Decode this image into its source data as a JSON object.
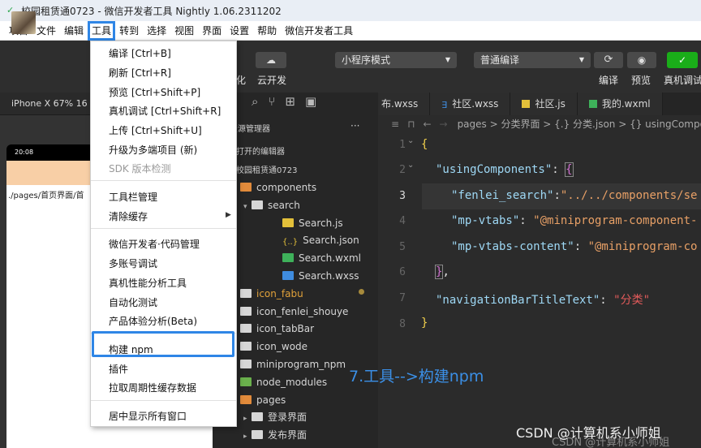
{
  "window": {
    "title": "校园租赁通0723 - 微信开发者工具 Nightly 1.06.2311202"
  },
  "menubar": {
    "items": [
      "项目",
      "文件",
      "编辑",
      "工具",
      "转到",
      "选择",
      "视图",
      "界面",
      "设置",
      "帮助",
      "微信开发者工具"
    ]
  },
  "toolbar": {
    "labels": [
      "化",
      "云开发"
    ],
    "mode_select": "小程序模式",
    "compile_select": "普通编译",
    "right_labels": [
      "编译",
      "预览",
      "真机调试"
    ]
  },
  "simulator": {
    "device": "iPhone X 67% 16 ▾",
    "time": "20:08",
    "path": "./pages/首页界面/首"
  },
  "explorer": {
    "header": "资源管理器",
    "more": "···",
    "open_editors": "打开的编辑器",
    "project": "校园租赁通0723",
    "rows": [
      {
        "label": "components",
        "icon": "folder-orange",
        "indent": 0,
        "arrow": "▾"
      },
      {
        "label": "search",
        "icon": "folder",
        "indent": 1,
        "arrow": "▾"
      },
      {
        "label": "Search.js",
        "icon": "js-ic",
        "indent": 2,
        "arrow": ""
      },
      {
        "label": "Search.json",
        "icon": "json-ic",
        "indent": 2,
        "arrow": ""
      },
      {
        "label": "Search.wxml",
        "icon": "wxml-ic",
        "indent": 2,
        "arrow": ""
      },
      {
        "label": "Search.wxss",
        "icon": "wxss-ic",
        "indent": 2,
        "arrow": ""
      },
      {
        "label": "icon_fabu",
        "icon": "folder",
        "indent": 0,
        "arrow": "▸"
      },
      {
        "label": "icon_fenlei_shouye",
        "icon": "folder",
        "indent": 0,
        "arrow": "▸"
      },
      {
        "label": "icon_tabBar",
        "icon": "folder",
        "indent": 0,
        "arrow": "▸"
      },
      {
        "label": "icon_wode",
        "icon": "folder",
        "indent": 0,
        "arrow": "▸"
      },
      {
        "label": "miniprogram_npm",
        "icon": "folder",
        "indent": 0,
        "arrow": "▸"
      },
      {
        "label": "node_modules",
        "icon": "folder-green",
        "indent": 0,
        "arrow": "▸"
      },
      {
        "label": "pages",
        "icon": "folder-orange",
        "indent": 0,
        "arrow": "▾"
      },
      {
        "label": "登录界面",
        "icon": "folder",
        "indent": 1,
        "arrow": "▸"
      },
      {
        "label": "发布界面",
        "icon": "folder",
        "indent": 1,
        "arrow": "▸"
      }
    ]
  },
  "tabs": [
    {
      "label": "布.wxss",
      "color": "#3f8cdf"
    },
    {
      "label": "社区.wxss",
      "color": "#3f8cdf"
    },
    {
      "label": "社区.js",
      "color": "#e3c03a"
    },
    {
      "label": "我的.wxml",
      "color": "#3eb15a"
    }
  ],
  "breadcrumb": "pages > 分类界面 > {.} 分类.json > {} usingComponents",
  "editor": {
    "line_numbers": [
      "1",
      "2",
      "3",
      "4",
      "5",
      "6",
      "7",
      "8"
    ],
    "l1": "{",
    "l2_key": "\"usingComponents\"",
    "l2_rest": ": ",
    "l2_brace": "{",
    "l3_key": "\"fenlei_search\"",
    "l3_colon": ":",
    "l3_val": "\"../../components/se",
    "l4_key": "\"mp-vtabs\"",
    "l4_colon": ": ",
    "l4_val": "\"@miniprogram-component-",
    "l5_key": "\"mp-vtabs-content\"",
    "l5_colon": ": ",
    "l5_val": "\"@miniprogram-co",
    "l6_brace": "}",
    "l6_comma": ",",
    "l7_key": "\"navigationBarTitleText\"",
    "l7_colon": ": ",
    "l7_val": "\"分类\"",
    "l8": "}"
  },
  "dropdown": {
    "items": [
      {
        "label": "编译  [Ctrl+B]"
      },
      {
        "label": "刷新  [Ctrl+R]"
      },
      {
        "label": "预览  [Ctrl+Shift+P]"
      },
      {
        "label": "真机调试  [Ctrl+Shift+R]"
      },
      {
        "label": "上传  [Ctrl+Shift+U]"
      },
      {
        "label": "升级为多端项目 (新)"
      },
      {
        "label": "SDK 版本检测"
      },
      {
        "label": "工具栏管理"
      },
      {
        "label": "清除缓存"
      },
      {
        "label": "微信开发者·代码管理"
      },
      {
        "label": "多账号调试"
      },
      {
        "label": "真机性能分析工具"
      },
      {
        "label": "自动化测试"
      },
      {
        "label": "产品体验分析(Beta)"
      },
      {
        "label": "构建 npm"
      },
      {
        "label": "插件"
      },
      {
        "label": "拉取周期性缓存数据"
      },
      {
        "label": "居中显示所有窗口"
      }
    ]
  },
  "annotation": "7.工具-->构建npm",
  "watermark": "CSDN @计算机系小师姐",
  "watermark_shadow": "CSDN @计算机系小师姐",
  "colors": {
    "accent": "#2f86e6",
    "green": "#1aad19",
    "string": "#e8a066",
    "key": "#9ed8f5"
  }
}
